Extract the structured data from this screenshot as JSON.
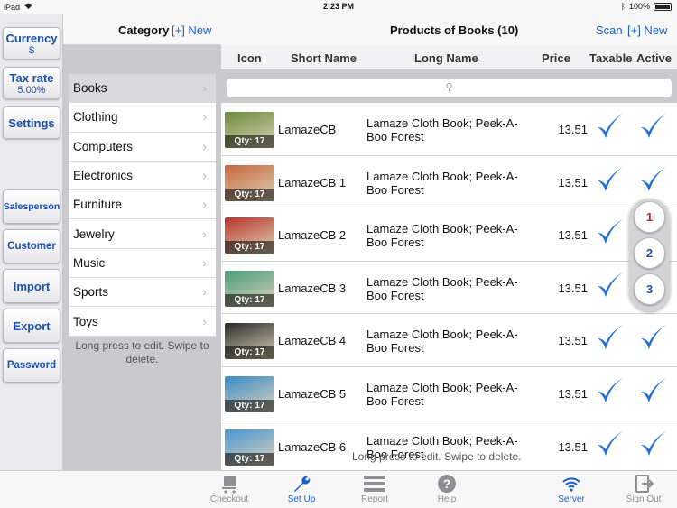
{
  "status": {
    "device": "iPad",
    "time": "2:23 PM",
    "battery": "100%"
  },
  "rail": {
    "currency_label": "Currency",
    "currency_value": "$",
    "taxrate_label": "Tax rate",
    "taxrate_value": "5.00%",
    "settings": "Settings",
    "salesperson": "Salesperson",
    "customer": "Customer",
    "import": "Import",
    "export": "Export",
    "password": "Password"
  },
  "category": {
    "title": "Category",
    "new": "[+] New",
    "items": [
      "Books",
      "Clothing",
      "Computers",
      "Electronics",
      "Furniture",
      "Jewelry",
      "Music",
      "Sports",
      "Toys"
    ],
    "selected": "Books",
    "hint": "Long press to edit. Swipe to delete."
  },
  "products": {
    "title": "Products of Books (10)",
    "scan": "Scan",
    "new": "[+] New",
    "columns": {
      "icon": "Icon",
      "short": "Short Name",
      "long": "Long Name",
      "price": "Price",
      "taxable": "Taxable",
      "active": "Active"
    },
    "rows": [
      {
        "qty": "Qty: 17",
        "short": "LamazeCB",
        "long": "Lamaze Cloth Book; Peek-A-Boo Forest",
        "price": "13.51"
      },
      {
        "qty": "Qty: 17",
        "short": "LamazeCB 1",
        "long": "Lamaze Cloth Book; Peek-A-Boo Forest",
        "price": "13.51"
      },
      {
        "qty": "Qty: 17",
        "short": "LamazeCB 2",
        "long": "Lamaze Cloth Book; Peek-A-Boo Forest",
        "price": "13.51"
      },
      {
        "qty": "Qty: 17",
        "short": "LamazeCB 3",
        "long": "Lamaze Cloth Book; Peek-A-Boo Forest",
        "price": "13.51"
      },
      {
        "qty": "Qty: 17",
        "short": "LamazeCB 4",
        "long": "Lamaze Cloth Book; Peek-A-Boo Forest",
        "price": "13.51"
      },
      {
        "qty": "Qty: 17",
        "short": "LamazeCB 5",
        "long": "Lamaze Cloth Book; Peek-A-Boo Forest",
        "price": "13.51"
      },
      {
        "qty": "Qty: 17",
        "short": "LamazeCB 6",
        "long": "Lamaze Cloth Book; Peek-A-Boo Forest",
        "price": "13.51"
      }
    ],
    "hint": "Long press to edit. Swipe to delete.",
    "pages": [
      "1",
      "2",
      "3"
    ],
    "active_page": "1"
  },
  "tabs": {
    "checkout": "Checkout",
    "setup": "Set Up",
    "report": "Report",
    "help": "Help",
    "server": "Server",
    "signout": "Sign Out"
  },
  "colors": {
    "accent": "#1a5fd0",
    "check": "#1f6fd6",
    "active_page": "#d62020"
  }
}
